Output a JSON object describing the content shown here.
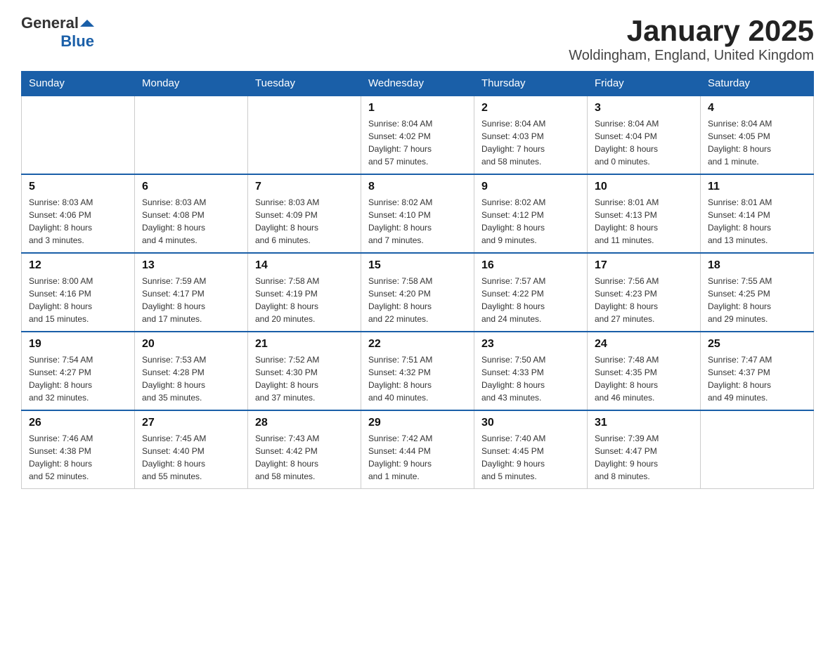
{
  "logo": {
    "text_general": "General",
    "text_blue": "Blue"
  },
  "header": {
    "title": "January 2025",
    "subtitle": "Woldingham, England, United Kingdom"
  },
  "days_of_week": [
    "Sunday",
    "Monday",
    "Tuesday",
    "Wednesday",
    "Thursday",
    "Friday",
    "Saturday"
  ],
  "weeks": [
    [
      {
        "day": "",
        "info": ""
      },
      {
        "day": "",
        "info": ""
      },
      {
        "day": "",
        "info": ""
      },
      {
        "day": "1",
        "info": "Sunrise: 8:04 AM\nSunset: 4:02 PM\nDaylight: 7 hours\nand 57 minutes."
      },
      {
        "day": "2",
        "info": "Sunrise: 8:04 AM\nSunset: 4:03 PM\nDaylight: 7 hours\nand 58 minutes."
      },
      {
        "day": "3",
        "info": "Sunrise: 8:04 AM\nSunset: 4:04 PM\nDaylight: 8 hours\nand 0 minutes."
      },
      {
        "day": "4",
        "info": "Sunrise: 8:04 AM\nSunset: 4:05 PM\nDaylight: 8 hours\nand 1 minute."
      }
    ],
    [
      {
        "day": "5",
        "info": "Sunrise: 8:03 AM\nSunset: 4:06 PM\nDaylight: 8 hours\nand 3 minutes."
      },
      {
        "day": "6",
        "info": "Sunrise: 8:03 AM\nSunset: 4:08 PM\nDaylight: 8 hours\nand 4 minutes."
      },
      {
        "day": "7",
        "info": "Sunrise: 8:03 AM\nSunset: 4:09 PM\nDaylight: 8 hours\nand 6 minutes."
      },
      {
        "day": "8",
        "info": "Sunrise: 8:02 AM\nSunset: 4:10 PM\nDaylight: 8 hours\nand 7 minutes."
      },
      {
        "day": "9",
        "info": "Sunrise: 8:02 AM\nSunset: 4:12 PM\nDaylight: 8 hours\nand 9 minutes."
      },
      {
        "day": "10",
        "info": "Sunrise: 8:01 AM\nSunset: 4:13 PM\nDaylight: 8 hours\nand 11 minutes."
      },
      {
        "day": "11",
        "info": "Sunrise: 8:01 AM\nSunset: 4:14 PM\nDaylight: 8 hours\nand 13 minutes."
      }
    ],
    [
      {
        "day": "12",
        "info": "Sunrise: 8:00 AM\nSunset: 4:16 PM\nDaylight: 8 hours\nand 15 minutes."
      },
      {
        "day": "13",
        "info": "Sunrise: 7:59 AM\nSunset: 4:17 PM\nDaylight: 8 hours\nand 17 minutes."
      },
      {
        "day": "14",
        "info": "Sunrise: 7:58 AM\nSunset: 4:19 PM\nDaylight: 8 hours\nand 20 minutes."
      },
      {
        "day": "15",
        "info": "Sunrise: 7:58 AM\nSunset: 4:20 PM\nDaylight: 8 hours\nand 22 minutes."
      },
      {
        "day": "16",
        "info": "Sunrise: 7:57 AM\nSunset: 4:22 PM\nDaylight: 8 hours\nand 24 minutes."
      },
      {
        "day": "17",
        "info": "Sunrise: 7:56 AM\nSunset: 4:23 PM\nDaylight: 8 hours\nand 27 minutes."
      },
      {
        "day": "18",
        "info": "Sunrise: 7:55 AM\nSunset: 4:25 PM\nDaylight: 8 hours\nand 29 minutes."
      }
    ],
    [
      {
        "day": "19",
        "info": "Sunrise: 7:54 AM\nSunset: 4:27 PM\nDaylight: 8 hours\nand 32 minutes."
      },
      {
        "day": "20",
        "info": "Sunrise: 7:53 AM\nSunset: 4:28 PM\nDaylight: 8 hours\nand 35 minutes."
      },
      {
        "day": "21",
        "info": "Sunrise: 7:52 AM\nSunset: 4:30 PM\nDaylight: 8 hours\nand 37 minutes."
      },
      {
        "day": "22",
        "info": "Sunrise: 7:51 AM\nSunset: 4:32 PM\nDaylight: 8 hours\nand 40 minutes."
      },
      {
        "day": "23",
        "info": "Sunrise: 7:50 AM\nSunset: 4:33 PM\nDaylight: 8 hours\nand 43 minutes."
      },
      {
        "day": "24",
        "info": "Sunrise: 7:48 AM\nSunset: 4:35 PM\nDaylight: 8 hours\nand 46 minutes."
      },
      {
        "day": "25",
        "info": "Sunrise: 7:47 AM\nSunset: 4:37 PM\nDaylight: 8 hours\nand 49 minutes."
      }
    ],
    [
      {
        "day": "26",
        "info": "Sunrise: 7:46 AM\nSunset: 4:38 PM\nDaylight: 8 hours\nand 52 minutes."
      },
      {
        "day": "27",
        "info": "Sunrise: 7:45 AM\nSunset: 4:40 PM\nDaylight: 8 hours\nand 55 minutes."
      },
      {
        "day": "28",
        "info": "Sunrise: 7:43 AM\nSunset: 4:42 PM\nDaylight: 8 hours\nand 58 minutes."
      },
      {
        "day": "29",
        "info": "Sunrise: 7:42 AM\nSunset: 4:44 PM\nDaylight: 9 hours\nand 1 minute."
      },
      {
        "day": "30",
        "info": "Sunrise: 7:40 AM\nSunset: 4:45 PM\nDaylight: 9 hours\nand 5 minutes."
      },
      {
        "day": "31",
        "info": "Sunrise: 7:39 AM\nSunset: 4:47 PM\nDaylight: 9 hours\nand 8 minutes."
      },
      {
        "day": "",
        "info": ""
      }
    ]
  ]
}
